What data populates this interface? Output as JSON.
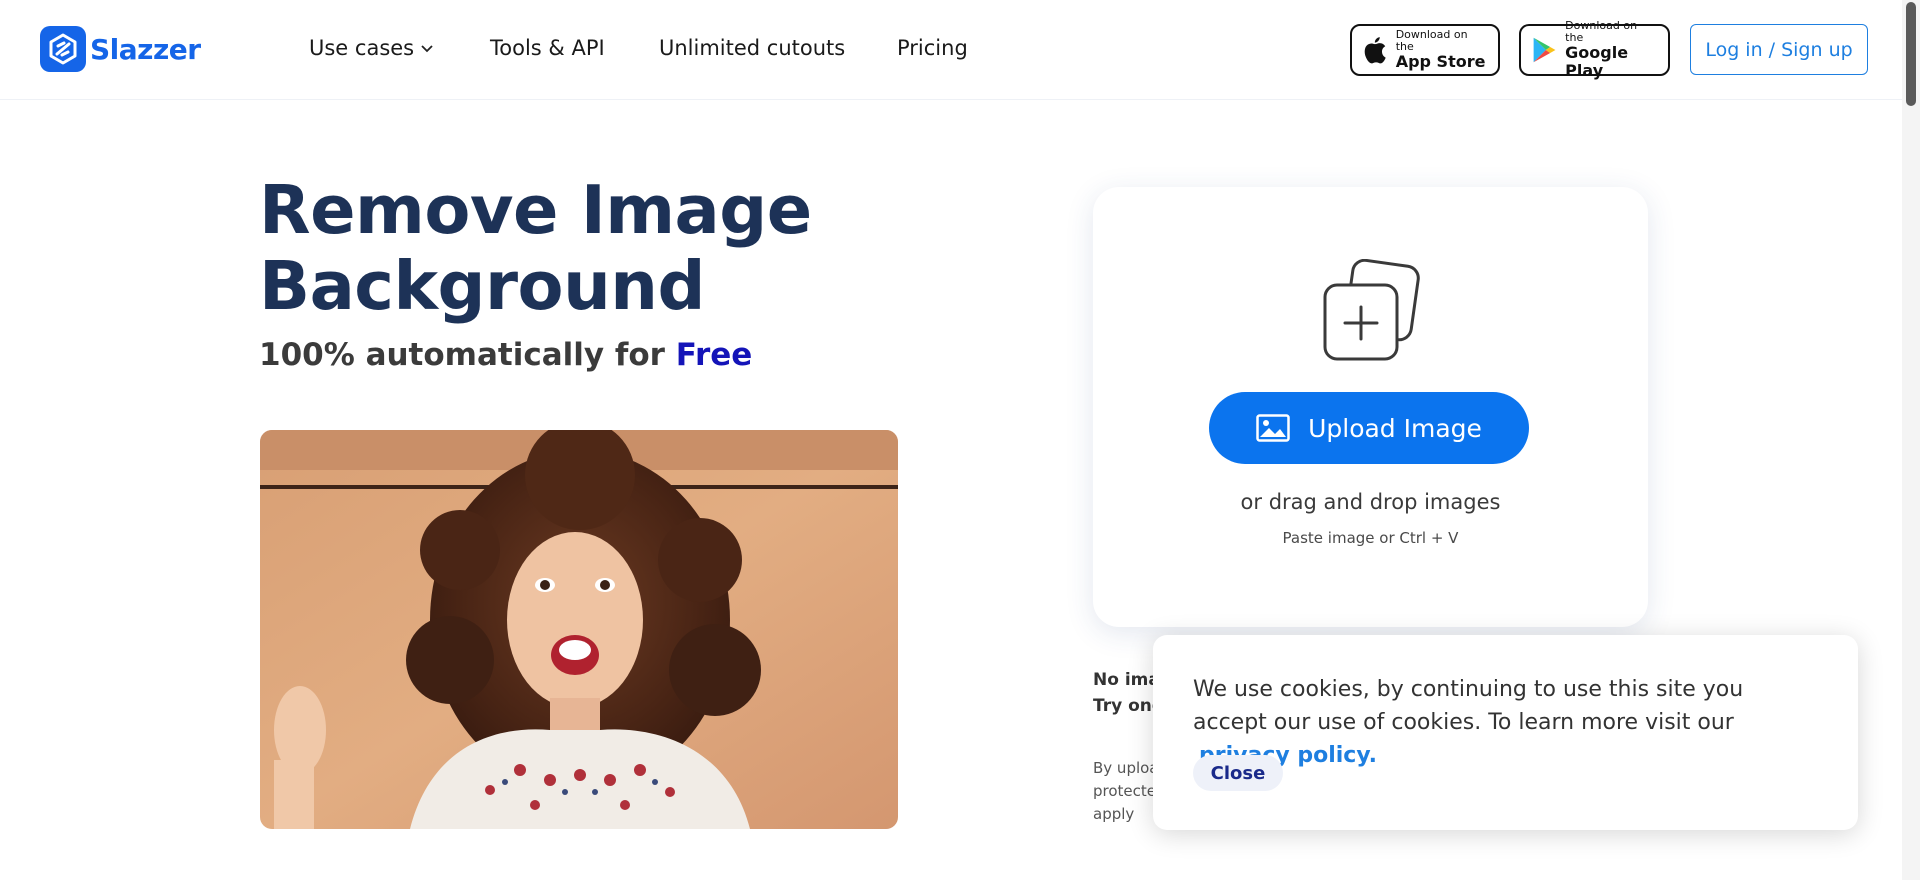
{
  "header": {
    "logo_text": "Slazzer",
    "nav": [
      {
        "label": "Use cases"
      },
      {
        "label": "Tools & API"
      },
      {
        "label": "Unlimited cutouts"
      },
      {
        "label": "Pricing"
      }
    ],
    "app_store": {
      "small": "Download on the",
      "big": "App Store"
    },
    "google_play": {
      "small": "Download on the",
      "big": "Google Play"
    },
    "login_label": "Log in / Sign up"
  },
  "hero": {
    "title": "Remove Image Background",
    "subtitle_prefix": "100% automatically for",
    "subtitle_highlight": "Free"
  },
  "upload": {
    "button_label": "Upload Image",
    "drag_text": "or drag and drop images",
    "paste_text": "Paste image or Ctrl + V"
  },
  "below_card": {
    "line1": "No ima",
    "line2": "Try one",
    "terms1": "By uploa",
    "terms2": "protecte",
    "terms3": "apply"
  },
  "cookie": {
    "text": "We use cookies, by continuing to use this site you accept our use of cookies.  To learn more visit our",
    "link": "privacy policy.",
    "close_label": "Close"
  },
  "colors": {
    "brand_blue": "#1565e8",
    "title_navy": "#1d3257",
    "free_blue": "#1414b8",
    "upload_blue": "#0b74ee",
    "link_blue": "#1e7fe0"
  }
}
